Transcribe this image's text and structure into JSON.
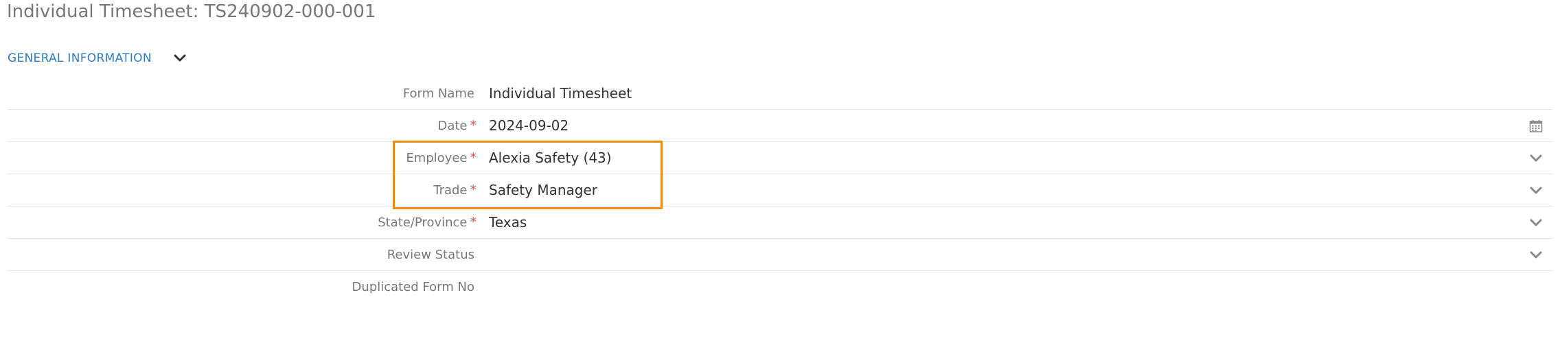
{
  "page": {
    "title": "Individual Timesheet: TS240902-000-001"
  },
  "section": {
    "title": "GENERAL INFORMATION"
  },
  "fields": [
    {
      "label": "Form Name",
      "required": false,
      "value": "Individual Timesheet",
      "action": ""
    },
    {
      "label": "Date",
      "required": true,
      "value": "2024-09-02",
      "action": "calendar-icon"
    },
    {
      "label": "Employee",
      "required": true,
      "value": "Alexia Safety (43)",
      "action": "chevron-down-icon"
    },
    {
      "label": "Trade",
      "required": true,
      "value": "Safety Manager",
      "action": "chevron-down-icon"
    },
    {
      "label": "State/Province",
      "required": true,
      "value": "Texas",
      "action": "chevron-down-icon"
    },
    {
      "label": "Review Status",
      "required": false,
      "value": "",
      "action": "chevron-down-icon"
    },
    {
      "label": "Duplicated Form No",
      "required": false,
      "value": "",
      "action": ""
    }
  ],
  "required_marker": "*",
  "colors": {
    "accent": "#2e7cc4",
    "required": "#d9534f",
    "highlight": "#f08a12",
    "label": "#777777",
    "icon": "#8a8a8a"
  }
}
